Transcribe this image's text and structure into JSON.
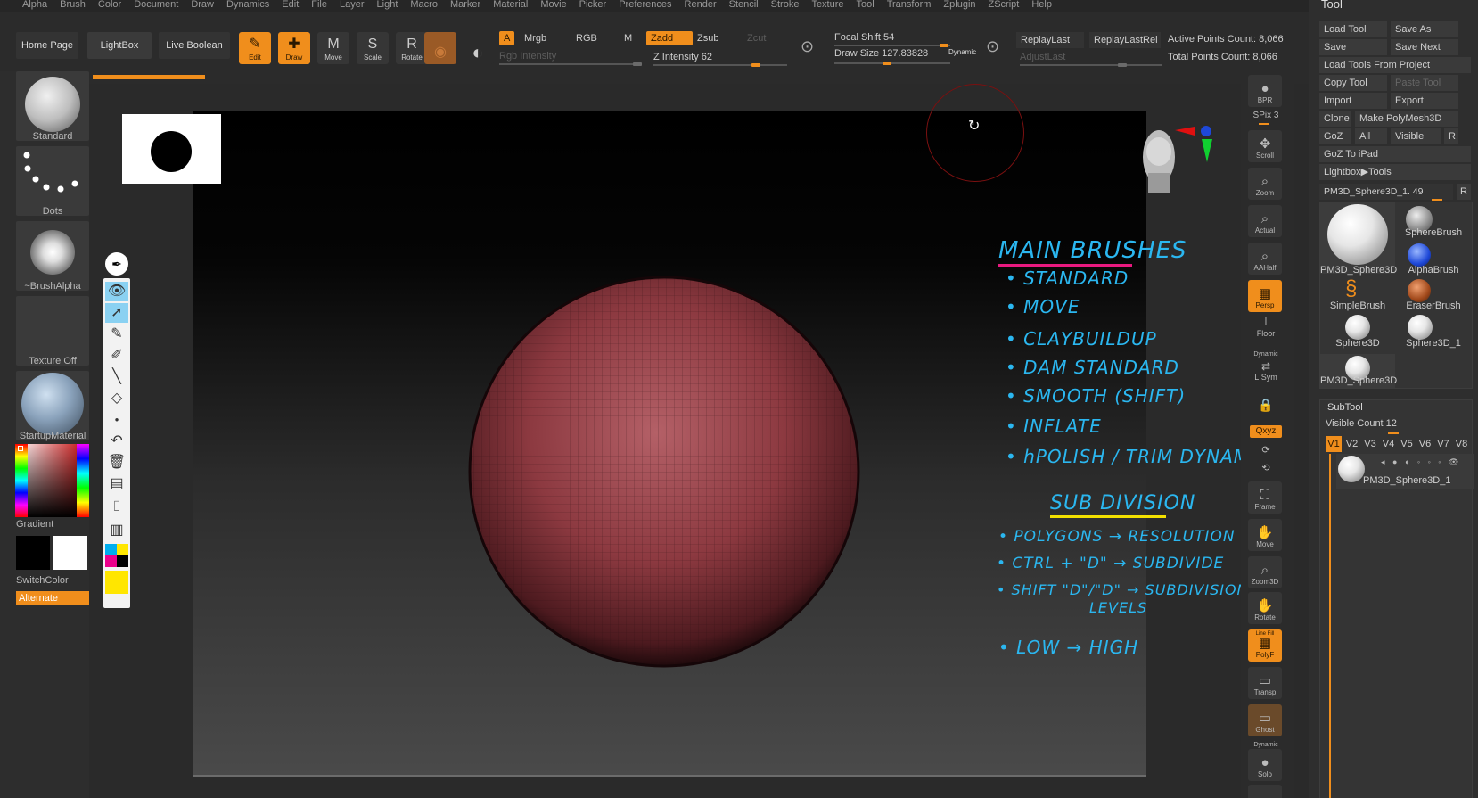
{
  "menu": [
    "Alpha",
    "Brush",
    "Color",
    "Document",
    "Draw",
    "Dynamics",
    "Edit",
    "File",
    "Layer",
    "Light",
    "Macro",
    "Marker",
    "Material",
    "Movie",
    "Picker",
    "Preferences",
    "Render",
    "Stencil",
    "Stroke",
    "Texture",
    "Tool",
    "Transform",
    "Zplugin",
    "ZScript",
    "Help"
  ],
  "shelf": {
    "home_page": "Home Page",
    "lightbox": "LightBox",
    "live_boolean": "Live Boolean",
    "tools": [
      {
        "label": "Edit",
        "icon": "edit-icon",
        "glyph": "✎",
        "on": true
      },
      {
        "label": "Draw",
        "icon": "draw-icon",
        "glyph": "✚",
        "on": true
      },
      {
        "label": "Move",
        "icon": "move-icon",
        "glyph": "M",
        "on": false
      },
      {
        "label": "Scale",
        "icon": "scale-icon",
        "glyph": "S",
        "on": false
      },
      {
        "label": "Rotate",
        "icon": "rotate-icon",
        "glyph": "R",
        "on": false
      }
    ],
    "a_label": "A",
    "mrgb": "Mrgb",
    "rgb": "RGB",
    "m": "M",
    "rgb_intensity": "Rgb Intensity",
    "zadd": "Zadd",
    "zsub": "Zsub",
    "zcut": "Zcut",
    "z_intensity": "Z Intensity 62",
    "focal_shift": "Focal Shift 54",
    "draw_size": "Draw Size 127.83828",
    "dynamic": "Dynamic",
    "replay_last": "ReplayLast",
    "replay_last_rel": "ReplayLastRel",
    "adjust_last": "AdjustLast",
    "active_points": "Active Points Count: 8,066",
    "total_points": "Total Points Count: 8,066"
  },
  "left_panel": {
    "brush": "Standard",
    "stroke": "Dots",
    "alpha": "~BrushAlpha",
    "texture": "Texture Off",
    "material": "StartupMaterial",
    "gradient": "Gradient",
    "switch_color": "SwitchColor",
    "alternate": "Alternate"
  },
  "nav": {
    "bpr": "BPR",
    "spix": "SPix 3",
    "buttons": [
      {
        "label": "Scroll",
        "icon": "scroll-icon",
        "glyph": "✥",
        "on": false
      },
      {
        "label": "Zoom",
        "icon": "zoom-icon",
        "glyph": "⌕",
        "on": false
      },
      {
        "label": "Actual",
        "icon": "actual-icon",
        "glyph": "⌕",
        "on": false
      },
      {
        "label": "AAHalf",
        "icon": "aahalf-icon",
        "glyph": "⌕",
        "on": false
      },
      {
        "label": "Persp",
        "icon": "persp-icon",
        "glyph": "▦",
        "on": true
      }
    ],
    "dynamic": "Dynamic",
    "floor": "Floor",
    "lsym": "L.Sym",
    "xyz": "Qxyz",
    "frame": "Frame",
    "move": "Move",
    "zoom3d": "Zoom3D",
    "rotate": "Rotate",
    "line_fill": "Line Fill",
    "polyf": "PolyF",
    "transp": "Transp",
    "ghost": "Ghost",
    "solo": "Solo"
  },
  "tool_panel": {
    "title": "Tool",
    "buttons": [
      {
        "label": "Load Tool",
        "dim": false
      },
      {
        "label": "Save As",
        "dim": false
      },
      {
        "label": "Save",
        "dim": false
      },
      {
        "label": "Save Next",
        "dim": false
      },
      {
        "label": "Load Tools From Project",
        "dim": false
      },
      {
        "label": "Copy Tool",
        "dim": false
      },
      {
        "label": "Paste Tool",
        "dim": true
      },
      {
        "label": "Import",
        "dim": false
      },
      {
        "label": "Export",
        "dim": false
      },
      {
        "label": "Clone",
        "dim": false
      },
      {
        "label": "Make PolyMesh3D",
        "dim": false
      },
      {
        "label": "GoZ",
        "dim": false
      },
      {
        "label": "All",
        "dim": false
      },
      {
        "label": "Visible",
        "dim": false
      },
      {
        "label": "R",
        "dim": false
      },
      {
        "label": "GoZ To iPad",
        "dim": false
      },
      {
        "label": "Lightbox▶Tools",
        "dim": false
      }
    ],
    "current_tool": "PM3D_Sphere3D_1. 49",
    "r": "R",
    "tools": [
      {
        "label": "PM3D_Sphere3D"
      },
      {
        "label": "SphereBrush"
      },
      {
        "label": "AlphaBrush"
      },
      {
        "label": "SimpleBrush"
      },
      {
        "label": "EraserBrush"
      },
      {
        "label": "Sphere3D"
      },
      {
        "label": "Sphere3D_1"
      },
      {
        "label": "PM3D_Sphere3D"
      }
    ],
    "subtool": "SubTool",
    "visible_count": "Visible Count 12",
    "v_tabs": [
      "V1",
      "V2",
      "V3",
      "V4",
      "V5",
      "V6",
      "V7",
      "V8"
    ],
    "subtool_item": "PM3D_Sphere3D_1"
  },
  "notes": {
    "main_brushes": "MAIN BRUSHES",
    "items": [
      "• STANDARD",
      "• MOVE",
      "• CLAYBUILDUP",
      "• DAM STANDARD",
      "• SMOOTH (SHIFT)",
      "• INFLATE",
      "• hPOLISH / TRIM DYNAMIC"
    ],
    "subdivision": "SUB DIVISION",
    "sub_items": [
      "• POLYGONS → RESOLUTION",
      "• CTRL + \"D\" → SUBDIVIDE",
      "• SHIFT \"D\"/\"D\" → SUBDIVISION",
      "LEVELS",
      "• LOW → HIGH"
    ]
  },
  "colors": {
    "accent": "#f08e1c",
    "note_blue": "#2bb7f0",
    "note_magenta": "#e8197f",
    "note_yellow": "#f3e000",
    "sphere": "#8c3940"
  }
}
